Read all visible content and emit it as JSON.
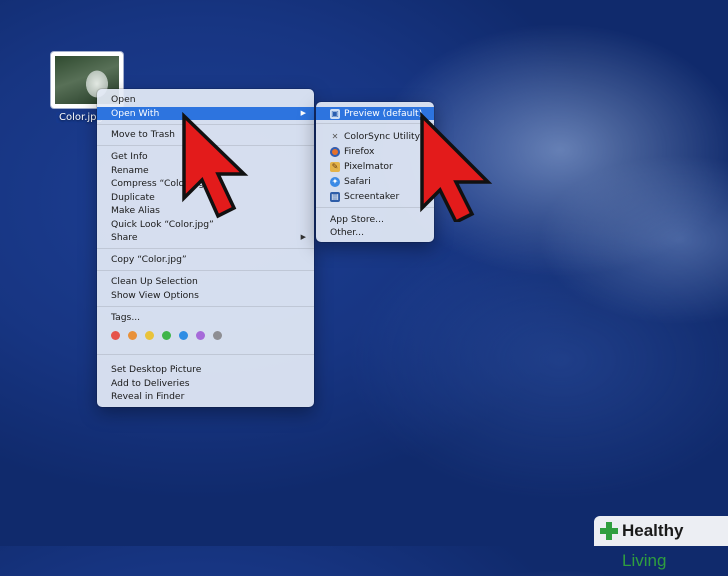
{
  "desktop": {
    "icon_label": "Color.jpg"
  },
  "context_menu": {
    "items": [
      {
        "label": "Open"
      },
      {
        "label": "Open With",
        "submenu": true,
        "highlighted": true
      },
      {
        "label": "Move to Trash"
      },
      {
        "label": "Get Info"
      },
      {
        "label": "Rename"
      },
      {
        "label": "Compress “Color.jpg”"
      },
      {
        "label": "Duplicate"
      },
      {
        "label": "Make Alias"
      },
      {
        "label": "Quick Look “Color.jpg”"
      },
      {
        "label": "Share",
        "submenu": true
      },
      {
        "label": "Copy “Color.jpg”"
      },
      {
        "label": "Clean Up Selection"
      },
      {
        "label": "Show View Options"
      },
      {
        "label": "Tags..."
      },
      {
        "label": "Set Desktop Picture"
      },
      {
        "label": "Add to Deliveries"
      },
      {
        "label": "Reveal in Finder"
      }
    ],
    "tag_colors": [
      "#e5534b",
      "#e8913a",
      "#e9c33b",
      "#3fb54a",
      "#2f8de4",
      "#a66ad9",
      "#8e8e93"
    ]
  },
  "submenu": {
    "items": [
      {
        "label": "Preview (default)",
        "icon": "preview-icon",
        "highlighted": true
      },
      {
        "label": "ColorSync Utility",
        "icon": "colorsync-icon"
      },
      {
        "label": "Firefox",
        "icon": "firefox-icon"
      },
      {
        "label": "Pixelmator",
        "icon": "pixelmator-icon"
      },
      {
        "label": "Safari",
        "icon": "safari-icon"
      },
      {
        "label": "Screentaker",
        "icon": "screentaker-icon"
      },
      {
        "label": "App Store..."
      },
      {
        "label": "Other..."
      }
    ]
  },
  "watermark": {
    "brand_bold": "Healthy",
    "brand_light": "Living"
  }
}
